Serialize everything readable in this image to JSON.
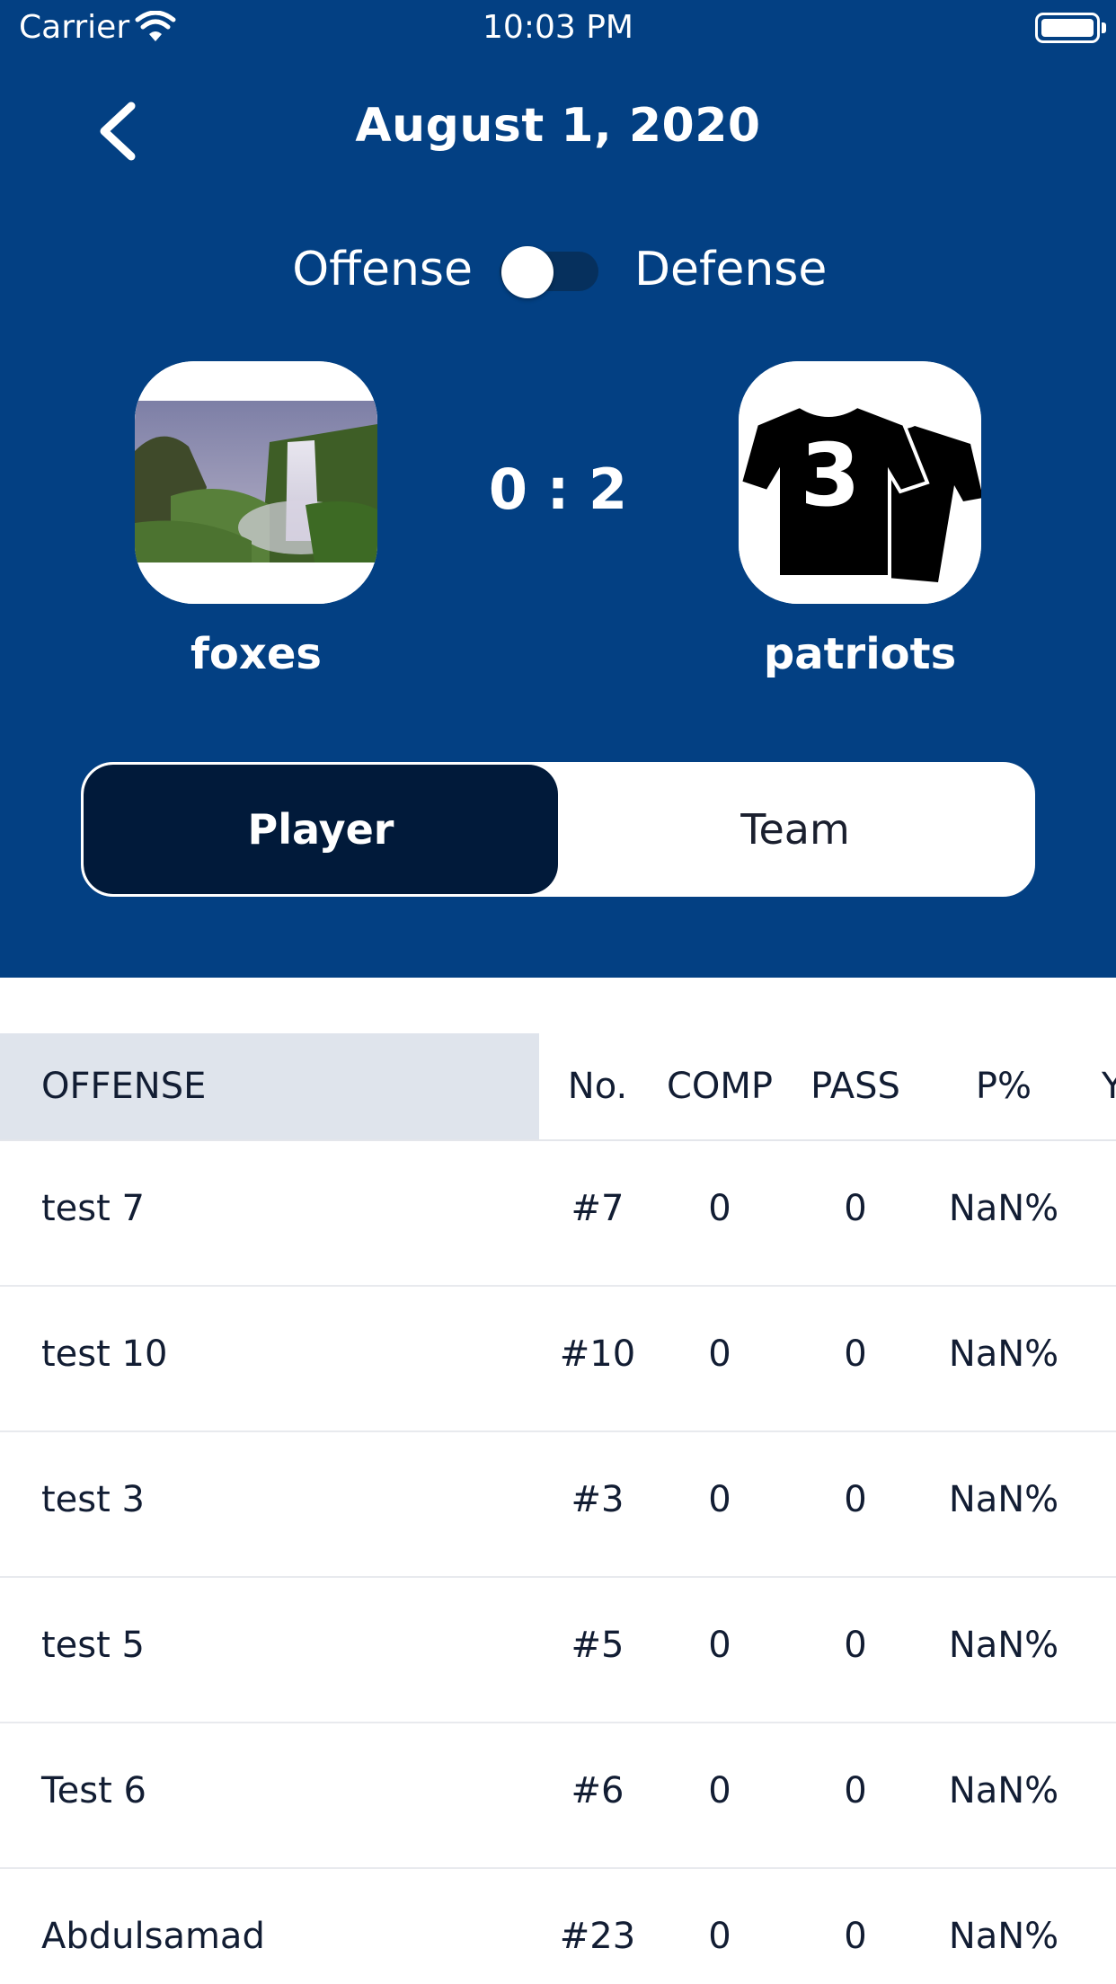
{
  "status_bar": {
    "carrier": "Carrier",
    "time": "10:03 PM"
  },
  "header": {
    "title": "August 1, 2020"
  },
  "mode_toggle": {
    "left_label": "Offense",
    "right_label": "Defense",
    "is_on": false
  },
  "match": {
    "home": {
      "name": "foxes",
      "logo": "waterfall-photo"
    },
    "away": {
      "name": "patriots",
      "logo": "jersey-3-icon"
    },
    "score": "0 : 2"
  },
  "segment": {
    "player_label": "Player",
    "team_label": "Team",
    "selected": "Player"
  },
  "table": {
    "section": "OFFENSE",
    "columns": [
      "No.",
      "COMP",
      "PASS",
      "P%",
      "Y"
    ],
    "rows": [
      {
        "name": "test 7",
        "no": "#7",
        "comp": "0",
        "pass": "0",
        "pct": "NaN%"
      },
      {
        "name": "test 10",
        "no": "#10",
        "comp": "0",
        "pass": "0",
        "pct": "NaN%"
      },
      {
        "name": "test 3",
        "no": "#3",
        "comp": "0",
        "pass": "0",
        "pct": "NaN%"
      },
      {
        "name": "test 5",
        "no": "#5",
        "comp": "0",
        "pass": "0",
        "pct": "NaN%"
      },
      {
        "name": "Test 6",
        "no": "#6",
        "comp": "0",
        "pass": "0",
        "pct": "NaN%"
      },
      {
        "name": "Abdulsamad",
        "no": "#23",
        "comp": "0",
        "pass": "0",
        "pct": "NaN%"
      }
    ]
  },
  "colors": {
    "header_bg": "#034083",
    "segment_selected": "#011a3a",
    "section_bg": "#dfe4ec",
    "text_dark": "#121d33"
  }
}
